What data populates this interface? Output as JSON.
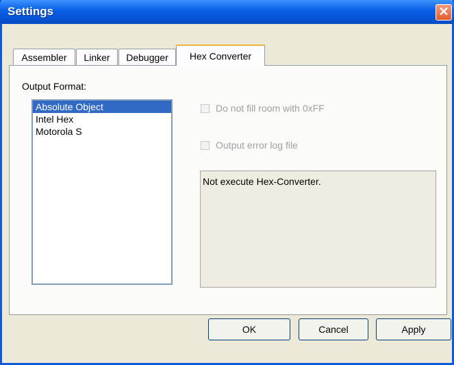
{
  "window": {
    "title": "Settings",
    "close_glyph": "✕"
  },
  "tabs": [
    {
      "label": "Assembler"
    },
    {
      "label": "Linker"
    },
    {
      "label": "Debugger"
    },
    {
      "label": "Hex Converter",
      "active": true
    }
  ],
  "panel": {
    "output_format_label": "Output Format:",
    "formats": [
      "Absolute Object",
      "Intel Hex",
      "Motorola S"
    ],
    "selected_format": "Absolute Object",
    "options": [
      {
        "label": "Do not fill room with 0xFF",
        "checked": false,
        "enabled": false
      },
      {
        "label": "Output error log file",
        "checked": false,
        "enabled": false
      }
    ],
    "message": "Not execute Hex-Converter."
  },
  "buttons": {
    "ok": "OK",
    "cancel": "Cancel",
    "apply": "Apply"
  },
  "colors": {
    "titlebar": "#0b62e8",
    "selection": "#316ac5",
    "tab_highlight": "#f1b43a"
  }
}
